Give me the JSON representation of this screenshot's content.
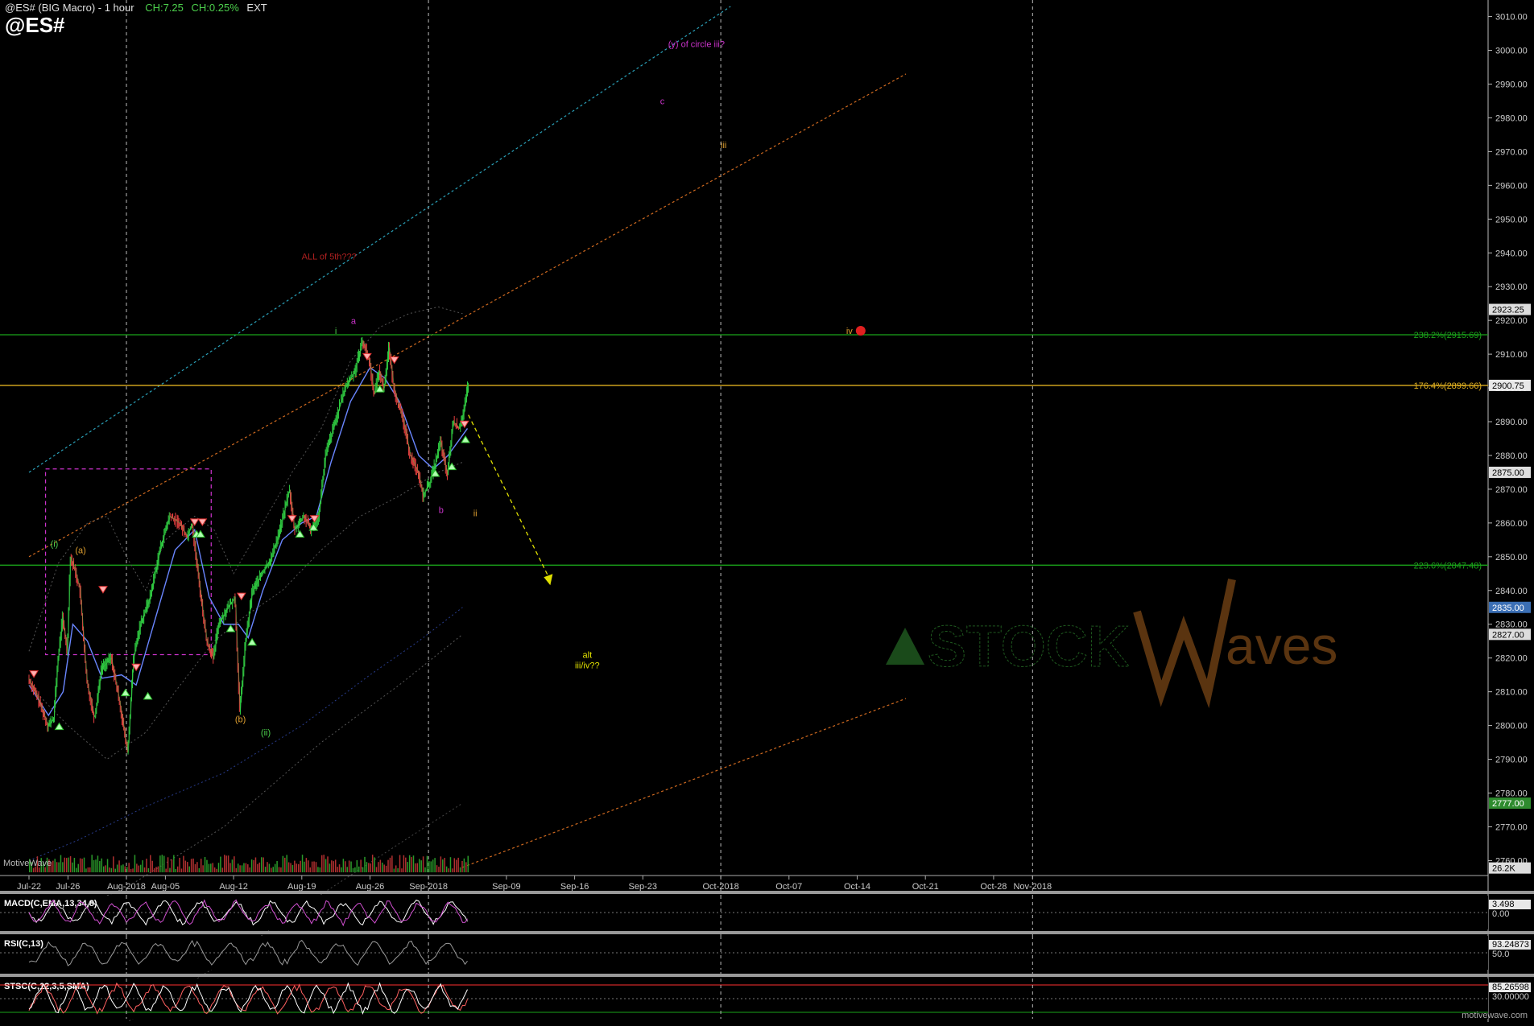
{
  "header": {
    "title": "@ES# (BIG Macro) - 1 hour",
    "change_points": "CH:7.25",
    "change_pct": "CH:0.25%",
    "session": "EXT",
    "symbol": "@ES#"
  },
  "watermark": {
    "brand": "MotiveWave",
    "site": "motivewave.com",
    "logo_text_left": "STOCK",
    "logo_text_right": "aves"
  },
  "colors": {
    "background": "#000000",
    "up_bar": "#2ecc40",
    "down_bar": "#e84040",
    "fib_green": "#1aa31a",
    "fib_orange": "#e0b020",
    "magenta": "#cc33cc",
    "orange_wave": "#e0a030"
  },
  "chart_data": [
    {
      "type": "line",
      "name": "price",
      "xlabel": "",
      "ylabel": "",
      "ylim": [
        2757,
        3013
      ],
      "y_ticks": [
        2760,
        2770,
        2780,
        2790,
        2800,
        2810,
        2820,
        2830,
        2840,
        2850,
        2860,
        2870,
        2880,
        2890,
        2900,
        2910,
        2920,
        2930,
        2940,
        2950,
        2960,
        2970,
        2980,
        2990,
        3000,
        3010
      ],
      "y_tick_labels": [
        "2760.00",
        "2770.00",
        "2780.00",
        "2790.00",
        "2800.00",
        "2810.00",
        "2820.00",
        "2830.00",
        "2840.00",
        "2850.00",
        "2860.00",
        "2870.00",
        "2880.00",
        "2890.00",
        "2900.00",
        "2910.00",
        "2920.00",
        "2930.00",
        "2940.00",
        "2950.00",
        "2960.00",
        "2970.00",
        "2980.00",
        "2990.00",
        "3000.00",
        "3010.00"
      ],
      "x_ticks": [
        "Jul-22",
        "Jul-26",
        "Aug-2018",
        "Aug-05",
        "Aug-12",
        "Aug-19",
        "Aug-26",
        "Sep-2018",
        "Sep-09",
        "Sep-16",
        "Sep-23",
        "Oct-2018",
        "Oct-07",
        "Oct-14",
        "Oct-21",
        "Oct-28",
        "Nov-2018"
      ],
      "x_tick_days": [
        0,
        4,
        10,
        14,
        21,
        28,
        35,
        41,
        49,
        56,
        63,
        71,
        78,
        85,
        92,
        99,
        103
      ],
      "month_dividers_days": [
        10,
        41,
        71,
        103
      ],
      "price_path": [
        [
          0,
          2814
        ],
        [
          1,
          2808
        ],
        [
          2,
          2800
        ],
        [
          2.6,
          2802
        ],
        [
          3,
          2818
        ],
        [
          3.5,
          2832
        ],
        [
          4,
          2822
        ],
        [
          4.3,
          2850
        ],
        [
          4.8,
          2846
        ],
        [
          5.3,
          2840
        ],
        [
          6,
          2813
        ],
        [
          6.8,
          2802
        ],
        [
          7.5,
          2817
        ],
        [
          8.5,
          2820
        ],
        [
          9.3,
          2808
        ],
        [
          10.2,
          2792
        ],
        [
          10.8,
          2820
        ],
        [
          11.5,
          2830
        ],
        [
          12.5,
          2838
        ],
        [
          13.5,
          2852
        ],
        [
          14.5,
          2862
        ],
        [
          15.5,
          2860
        ],
        [
          16.3,
          2856
        ],
        [
          16.8,
          2860
        ],
        [
          17.5,
          2843
        ],
        [
          18.3,
          2825
        ],
        [
          19,
          2820
        ],
        [
          19.5,
          2830
        ],
        [
          20.5,
          2835
        ],
        [
          21.2,
          2838
        ],
        [
          21.7,
          2804
        ],
        [
          22.3,
          2825
        ],
        [
          23,
          2840
        ],
        [
          24,
          2845
        ],
        [
          25,
          2850
        ],
        [
          26,
          2860
        ],
        [
          26.8,
          2870
        ],
        [
          27.3,
          2858
        ],
        [
          28.3,
          2862
        ],
        [
          29,
          2858
        ],
        [
          29.8,
          2862
        ],
        [
          30.5,
          2880
        ],
        [
          31.5,
          2890
        ],
        [
          32.5,
          2900
        ],
        [
          33.5,
          2905
        ],
        [
          34.3,
          2914
        ],
        [
          35,
          2908
        ],
        [
          35.5,
          2898
        ],
        [
          36,
          2905
        ],
        [
          36.5,
          2900
        ],
        [
          37,
          2912
        ],
        [
          37.5,
          2900
        ],
        [
          38.5,
          2890
        ],
        [
          39.2,
          2880
        ],
        [
          40,
          2875
        ],
        [
          40.5,
          2868
        ],
        [
          41.2,
          2872
        ],
        [
          41.8,
          2878
        ],
        [
          42.3,
          2884
        ],
        [
          43,
          2874
        ],
        [
          43.6,
          2890
        ],
        [
          44.2,
          2888
        ],
        [
          44.7,
          2893
        ],
        [
          45.1,
          2900
        ]
      ],
      "series": [
        {
          "name": "",
          "role": "fast_ma",
          "points": [
            [
              0,
              2812
            ],
            [
              2,
              2803
            ],
            [
              3.5,
              2810
            ],
            [
              4.5,
              2830
            ],
            [
              6,
              2825
            ],
            [
              7.5,
              2814
            ],
            [
              9.5,
              2815
            ],
            [
              11,
              2812
            ],
            [
              13,
              2832
            ],
            [
              15,
              2852
            ],
            [
              17,
              2858
            ],
            [
              18.5,
              2838
            ],
            [
              20,
              2830
            ],
            [
              21.5,
              2830
            ],
            [
              22.5,
              2826
            ],
            [
              24,
              2840
            ],
            [
              26,
              2855
            ],
            [
              28,
              2860
            ],
            [
              29.5,
              2862
            ],
            [
              31,
              2878
            ],
            [
              33,
              2896
            ],
            [
              35,
              2906
            ],
            [
              36.5,
              2903
            ],
            [
              38,
              2896
            ],
            [
              40,
              2880
            ],
            [
              41.5,
              2876
            ],
            [
              43,
              2880
            ],
            [
              45,
              2888
            ]
          ]
        },
        {
          "name": "",
          "role": "upper_band",
          "points": [
            [
              0,
              2822
            ],
            [
              3,
              2848
            ],
            [
              6,
              2860
            ],
            [
              8,
              2862
            ],
            [
              10,
              2850
            ],
            [
              12,
              2840
            ],
            [
              14,
              2855
            ],
            [
              17,
              2862
            ],
            [
              19,
              2858
            ],
            [
              21,
              2845
            ],
            [
              24,
              2860
            ],
            [
              27,
              2875
            ],
            [
              30,
              2888
            ],
            [
              33,
              2908
            ],
            [
              36,
              2918
            ],
            [
              39,
              2922
            ],
            [
              42,
              2924
            ],
            [
              44.5,
              2922
            ]
          ]
        },
        {
          "name": "",
          "role": "lower_band",
          "points": [
            [
              0,
              2812
            ],
            [
              4,
              2800
            ],
            [
              8,
              2790
            ],
            [
              12,
              2798
            ],
            [
              15,
              2810
            ],
            [
              19,
              2825
            ],
            [
              22,
              2832
            ],
            [
              26,
              2840
            ],
            [
              30,
              2852
            ],
            [
              34,
              2862
            ],
            [
              38,
              2868
            ],
            [
              42,
              2875
            ],
            [
              44.5,
              2878
            ]
          ]
        },
        {
          "name": "",
          "role": "blue_envelope",
          "points": [
            [
              0,
              2760
            ],
            [
              5,
              2766
            ],
            [
              12,
              2776
            ],
            [
              20,
              2786
            ],
            [
              28,
              2800
            ],
            [
              35,
              2815
            ],
            [
              40,
              2825
            ],
            [
              44.5,
              2835
            ]
          ]
        },
        {
          "name": "",
          "role": "lower_envelope",
          "points": [
            [
              0,
              2740
            ],
            [
              10,
              2752
            ],
            [
              20,
              2770
            ],
            [
              30,
              2795
            ],
            [
              38,
              2812
            ],
            [
              44.5,
              2827
            ]
          ]
        },
        {
          "name": "",
          "role": "bottom_envelope",
          "points": [
            [
              0,
              2700
            ],
            [
              10,
              2712
            ],
            [
              20,
              2730
            ],
            [
              30,
              2750
            ],
            [
              38,
              2765
            ],
            [
              44.5,
              2777
            ]
          ]
        }
      ],
      "trendlines": [
        {
          "name": "",
          "style": "dotted",
          "color": "#2aa0b8",
          "from": [
            0,
            2875
          ],
          "to": [
            72,
            3013
          ]
        },
        {
          "name": "",
          "style": "dotted",
          "color": "#d06a20",
          "from": [
            0,
            2850
          ],
          "to": [
            90,
            2993
          ]
        },
        {
          "name": "",
          "style": "dotted",
          "color": "#d06a20",
          "from": [
            44.5,
            2758
          ],
          "to": [
            90,
            2808
          ]
        }
      ],
      "horizontal_levels": [
        {
          "value": 2900.75,
          "color": "#e0b020",
          "label": "176.4%(2899.66)"
        },
        {
          "value": 2915.75,
          "color": "#1aa31a",
          "label": "238.2%(2915.69)"
        },
        {
          "value": 2847.5,
          "color": "#1aa31a",
          "label": "223.6%(2847.48)"
        }
      ],
      "projection": {
        "from": [
          45.1,
          2892
        ],
        "to": [
          53.5,
          2843
        ],
        "color": "#e0e000"
      },
      "price_labels": [
        {
          "value": 2923.25,
          "text": "2923.25",
          "bg": "#dddddd",
          "fg": "#000000"
        },
        {
          "value": 2900.75,
          "text": "2900.75",
          "bg": "#e8e8e8",
          "fg": "#000000"
        },
        {
          "value": 2875.0,
          "text": "2875.00",
          "bg": "#dddddd",
          "fg": "#000000"
        },
        {
          "value": 2835.0,
          "text": "2835.00",
          "bg": "#3b6fb5",
          "fg": "#ffffff"
        },
        {
          "value": 2827.0,
          "text": "2827.00",
          "bg": "#dddddd",
          "fg": "#000000"
        },
        {
          "value": 2777.0,
          "text": "2777.00",
          "bg": "#2e8b2e",
          "fg": "#ffffff"
        },
        {
          "value": 2757.8,
          "text": "26.2K",
          "bg": "#dddddd",
          "fg": "#000000"
        }
      ],
      "wave_labels": [
        {
          "text": "(i)",
          "day": 2.6,
          "value": 2853,
          "color": "#4ccf4c"
        },
        {
          "text": "(a)",
          "day": 5.3,
          "value": 2851,
          "color": "#e0a030"
        },
        {
          "text": "(b)",
          "day": 21.7,
          "value": 2801,
          "color": "#e0a030"
        },
        {
          "text": "(ii)",
          "day": 24.3,
          "value": 2797,
          "color": "#4ccf4c"
        },
        {
          "text": "i",
          "day": 31.5,
          "value": 2916,
          "color": "#4ccf4c"
        },
        {
          "text": "a",
          "day": 33.3,
          "value": 2919,
          "color": "#cc33cc"
        },
        {
          "text": "ALL of 5th???",
          "day": 30.8,
          "value": 2938,
          "color": "#b02020"
        },
        {
          "text": "b",
          "day": 42.3,
          "value": 2863,
          "color": "#cc33cc"
        },
        {
          "text": "ii",
          "day": 45.8,
          "value": 2862,
          "color": "#e0a030"
        },
        {
          "text": "c",
          "day": 65.0,
          "value": 2984,
          "color": "#cc33cc"
        },
        {
          "text": "(y) of circle iii?",
          "day": 68.5,
          "value": 3001,
          "color": "#cc33cc"
        },
        {
          "text": "iii",
          "day": 71.3,
          "value": 2971,
          "color": "#e0a030"
        },
        {
          "text": "iv",
          "day": 84.2,
          "value": 2916,
          "color": "#e0a030"
        },
        {
          "text": "alt",
          "day": 57.3,
          "value": 2820,
          "color": "#e0e000"
        },
        {
          "text": "iii/iv??",
          "day": 57.3,
          "value": 2817,
          "color": "#e0e000"
        }
      ],
      "dashed_box": {
        "from": [
          1.7,
          2876
        ],
        "to": [
          18.7,
          2821
        ],
        "color": "#cc33cc"
      },
      "signal_markers": {
        "down": [
          [
            0.5,
            2815
          ],
          [
            7.6,
            2840
          ],
          [
            11,
            2817
          ],
          [
            17,
            2860
          ],
          [
            17.8,
            2860
          ],
          [
            21.8,
            2838
          ],
          [
            27,
            2861
          ],
          [
            29.3,
            2861
          ],
          [
            34.7,
            2909
          ],
          [
            37.5,
            2908
          ],
          [
            44.7,
            2889
          ]
        ],
        "up": [
          [
            3.1,
            2800
          ],
          [
            9.9,
            2810
          ],
          [
            12.2,
            2809
          ],
          [
            17.2,
            2857
          ],
          [
            17.6,
            2857
          ],
          [
            20.7,
            2829
          ],
          [
            22.9,
            2825
          ],
          [
            27.8,
            2857
          ],
          [
            29.2,
            2859
          ],
          [
            36,
            2900
          ],
          [
            41.7,
            2875
          ],
          [
            43.4,
            2877
          ],
          [
            44.8,
            2885
          ]
        ]
      },
      "volume_label": "26.2K"
    },
    {
      "type": "line",
      "title": "MACD(C,EMA,13,34,8)",
      "values_text": [
        "3.498",
        "0.00"
      ],
      "series": [
        {
          "name": "",
          "role": "macd_line",
          "color": "#ffffff"
        },
        {
          "name": "",
          "role": "signal_line",
          "color": "#d04fd0"
        }
      ]
    },
    {
      "type": "line",
      "title": "RSI(C,13)",
      "values_text": [
        "93.24873",
        "50.0"
      ],
      "series": [
        {
          "name": "",
          "role": "rsi",
          "color": "#999999"
        }
      ]
    },
    {
      "type": "line",
      "title": "STSC(C,12,3,5,SMA)",
      "values_text": [
        "85.26598",
        "30.00000"
      ],
      "levels": [
        {
          "value": 85,
          "color": "#ff3030"
        },
        {
          "value": 30,
          "color": "#1aa31a"
        }
      ],
      "series": [
        {
          "name": "",
          "role": "stoch_k",
          "color": "#ff6060"
        },
        {
          "name": "",
          "role": "stoch_d",
          "color": "#ffffff"
        }
      ]
    }
  ]
}
